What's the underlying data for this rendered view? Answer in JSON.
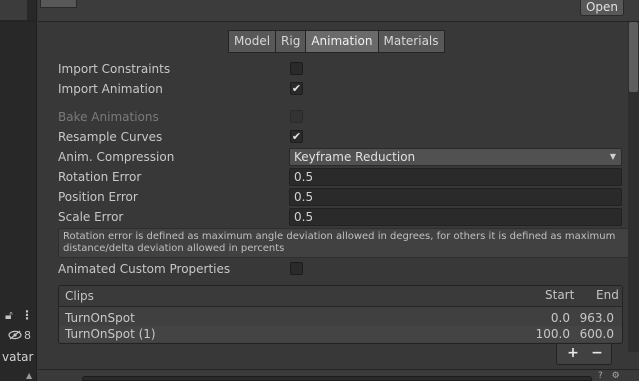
{
  "header": {
    "open_label": "Open"
  },
  "tabs": [
    {
      "label": "Model",
      "active": false
    },
    {
      "label": "Rig",
      "active": false
    },
    {
      "label": "Animation",
      "active": true
    },
    {
      "label": "Materials",
      "active": false
    }
  ],
  "settings": {
    "import_constraints": {
      "label": "Import Constraints",
      "checked": false
    },
    "import_animation": {
      "label": "Import Animation",
      "checked": true
    },
    "bake_animations": {
      "label": "Bake Animations",
      "checked": false,
      "disabled": true
    },
    "resample_curves": {
      "label": "Resample Curves",
      "checked": true
    },
    "anim_compression": {
      "label": "Anim. Compression",
      "value": "Keyframe Reduction"
    },
    "rotation_error": {
      "label": "Rotation Error",
      "value": "0.5"
    },
    "position_error": {
      "label": "Position Error",
      "value": "0.5"
    },
    "scale_error": {
      "label": "Scale Error",
      "value": "0.5"
    },
    "help_text": "Rotation error is defined as maximum angle deviation allowed in degrees, for others it is defined as maximum distance/delta deviation allowed in percents",
    "animated_custom_properties": {
      "label": "Animated Custom Properties",
      "checked": false
    }
  },
  "clips": {
    "headers": {
      "name": "Clips",
      "start": "Start",
      "end": "End"
    },
    "rows": [
      {
        "name": "TurnOnSpot",
        "start": "0.0",
        "end": "963.0"
      },
      {
        "name": "TurnOnSpot (1)",
        "start": "100.0",
        "end": "600.0"
      }
    ],
    "add_label": "+",
    "remove_label": "−"
  },
  "left_panel": {
    "lock_icon": "lock-icon",
    "menu_icon": "kebab-menu-icon",
    "visibility_icon": "eye-slash-icon",
    "visibility_count": "8",
    "avatar_text": "vatar"
  },
  "icons": {
    "check": "✔",
    "dropdown_arrow": "▼"
  }
}
